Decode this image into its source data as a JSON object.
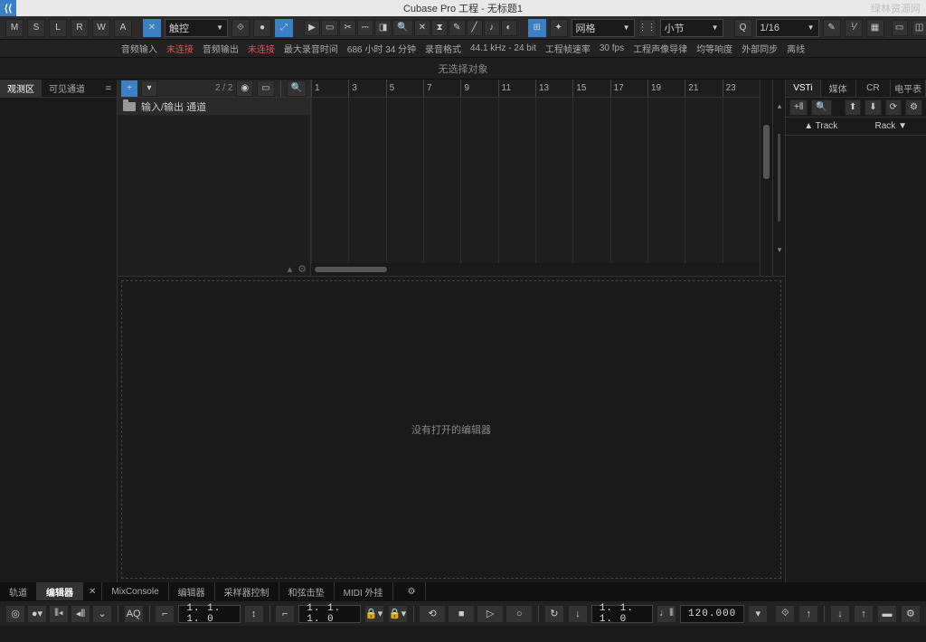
{
  "title": "Cubase Pro 工程 - 无标题1",
  "watermark": "绿林资源网",
  "toolbar1": {
    "m": "M",
    "s": "S",
    "l": "L",
    "r": "R",
    "w": "W",
    "a": "A",
    "touch": "触控",
    "grid": "网格",
    "bar": "小节",
    "quant": "1/16"
  },
  "toolbar2": {
    "audioIn": "音频输入",
    "notConn1": "未连接",
    "audioOut": "音频输出",
    "notConn2": "未连接",
    "maxRec": "最大录音时间",
    "recTime": "686 小时 34 分钟",
    "recFmt": "录音格式",
    "fmt": "44.1 kHz - 24 bit",
    "frameRate": "工程帧速率",
    "fps": "30 fps",
    "panLaw": "工程声像导律",
    "equal": "均等响度",
    "extSync": "外部同步",
    "offline": "离线"
  },
  "noSelection": "无选择对象",
  "leftTabs": {
    "observe": "观测区",
    "visible": "可见通道"
  },
  "trackList": {
    "count": "2 / 2",
    "ioTrack": "输入/输出 通道"
  },
  "ruler": [
    "1",
    "3",
    "5",
    "7",
    "9",
    "11",
    "13",
    "15",
    "17",
    "19",
    "21",
    "23"
  ],
  "editorEmpty": "没有打开的编辑器",
  "rightTabs": {
    "vsti": "VSTi",
    "media": "媒体",
    "cr": "CR",
    "meter": "电平表"
  },
  "rightHdr": {
    "track": "▲ Track",
    "rack": "Rack ▼"
  },
  "bottomTabs": {
    "track": "轨道",
    "editor": "编辑器",
    "mix": "MixConsole",
    "editor2": "编辑器",
    "sampler": "采样器控制",
    "chord": "和弦击垫",
    "midi": "MIDI 外挂"
  },
  "transport": {
    "aq": "AQ",
    "pos1": "1. 1. 1.  0",
    "pos2": "1. 1. 1.  0",
    "pos3": "1. 1. 1.  0",
    "tempo": "120.000"
  }
}
